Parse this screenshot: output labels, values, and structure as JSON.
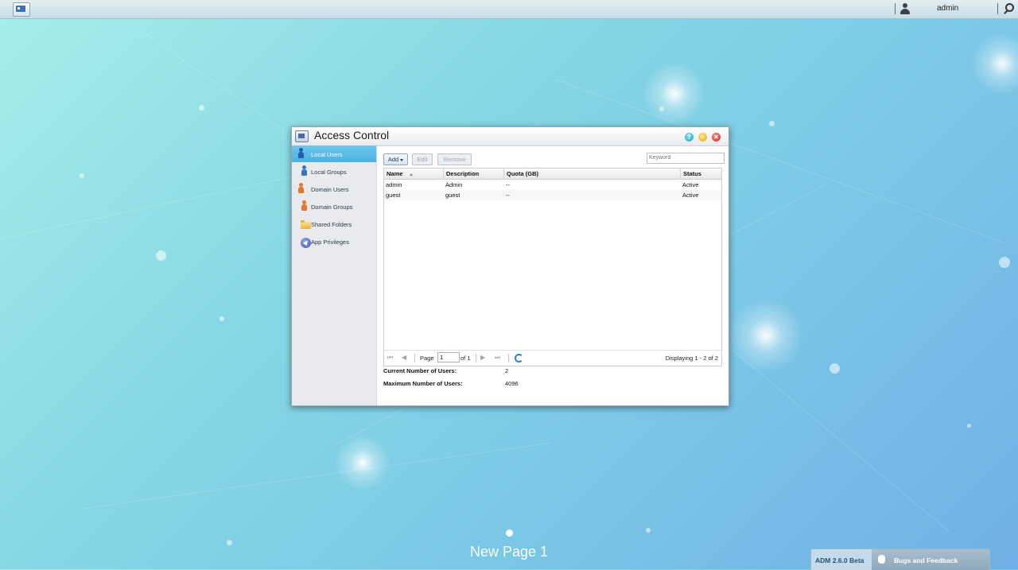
{
  "top_bar": {
    "username": "admin"
  },
  "window": {
    "title": "Access Control",
    "sidebar": [
      {
        "label": "Local Users",
        "icon": "person-icon",
        "active": true
      },
      {
        "label": "Local Groups",
        "icon": "group-icon",
        "active": false
      },
      {
        "label": "Domain Users",
        "icon": "domain-user-icon",
        "active": false
      },
      {
        "label": "Domain Groups",
        "icon": "domain-group-icon",
        "active": false
      },
      {
        "label": "Shared Folders",
        "icon": "folder-icon",
        "active": false
      },
      {
        "label": "App Privileges",
        "icon": "rocket-icon",
        "active": false
      }
    ],
    "toolbar": {
      "add_label": "Add",
      "edit_label": "Edit",
      "remove_label": "Remove",
      "search_placeholder": "Keyword"
    },
    "table": {
      "columns": [
        "Name",
        "Description",
        "Quota (GB)",
        "Status"
      ],
      "rows": [
        [
          "admin",
          "Admin",
          "--",
          "Active"
        ],
        [
          "guest",
          "guest",
          "--",
          "Active"
        ]
      ]
    },
    "pager": {
      "page_label": "Page",
      "page_value": "1",
      "of_label": "of 1",
      "displaying": "Displaying 1 - 2 of 2"
    },
    "stats": {
      "current_label": "Current Number of Users:",
      "current_value": "2",
      "max_label": "Maximum Number of Users:",
      "max_value": "4096"
    }
  },
  "desktop": {
    "page_label": "New Page 1"
  },
  "footer": {
    "version": "ADM 2.6.0 Beta",
    "feedback": "Bugs and Feedback"
  },
  "colors": {
    "accent": "#4ab2e2",
    "close": "#d2231a",
    "minimize": "#e6a415",
    "help": "#1ea2bd"
  }
}
